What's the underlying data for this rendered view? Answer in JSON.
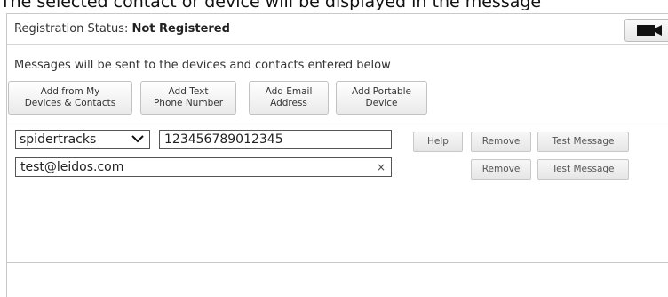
{
  "page": {
    "top_text": "The selected contact or device will be displayed in the message"
  },
  "registration": {
    "label": "Registration Status:",
    "status": "Not Registered"
  },
  "video_button": {
    "icon": "video-camera-icon"
  },
  "instructions": "Messages will be sent to the devices and contacts entered below",
  "add_buttons": {
    "from_devices": "Add from My\nDevices & Contacts",
    "text_phone": "Add Text\nPhone Number",
    "email": "Add Email\nAddress",
    "portable": "Add Portable\nDevice"
  },
  "recipients": [
    {
      "select_value": "spidertracks",
      "field_value": "123456789012345",
      "help_label": "Help",
      "remove_label": "Remove",
      "test_label": "Test Message"
    },
    {
      "field_value": "test@leidos.com",
      "clear_symbol": "×",
      "remove_label": "Remove",
      "test_label": "Test Message"
    }
  ]
}
